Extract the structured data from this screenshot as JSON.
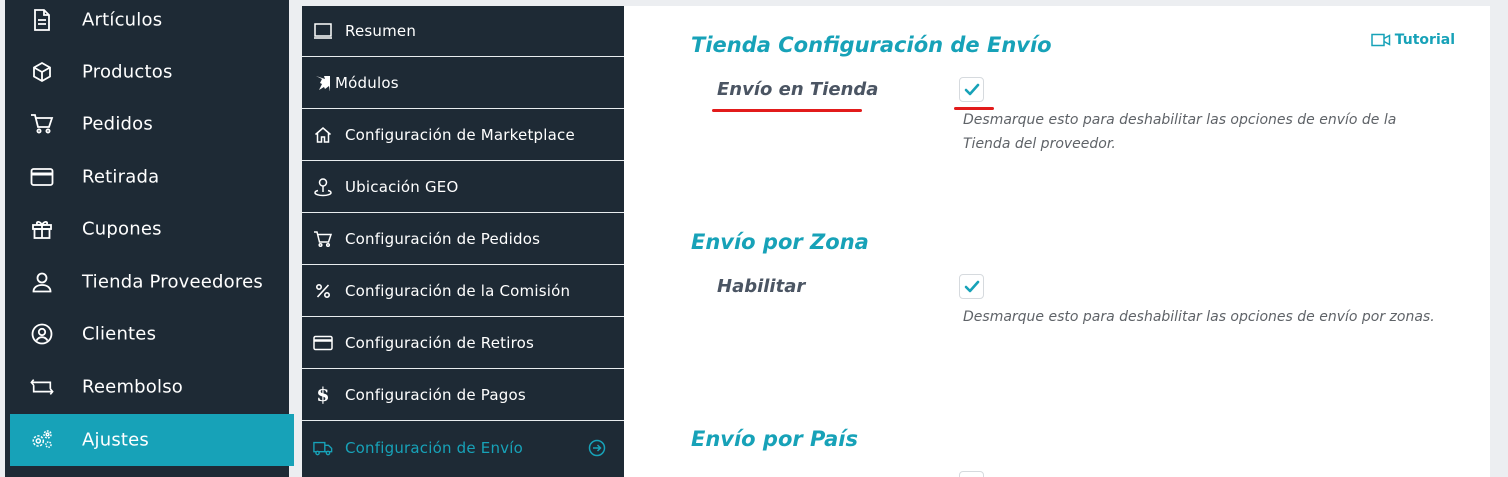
{
  "sidebar": {
    "items": [
      {
        "label": "Artículos",
        "icon": "document-icon"
      },
      {
        "label": "Productos",
        "icon": "cube-icon"
      },
      {
        "label": "Pedidos",
        "icon": "cart-icon"
      },
      {
        "label": "Retirada",
        "icon": "credit-card-icon"
      },
      {
        "label": "Cupones",
        "icon": "gift-icon"
      },
      {
        "label": "Tienda Proveedores",
        "icon": "user-icon"
      },
      {
        "label": "Clientes",
        "icon": "user-circle-icon"
      },
      {
        "label": "Reembolso",
        "icon": "repeat-icon"
      },
      {
        "label": "Ajustes",
        "icon": "gears-icon",
        "active": true
      }
    ]
  },
  "settings_menu": {
    "items": [
      {
        "label": "Resumen",
        "icon": "monitor-icon"
      },
      {
        "label": "Módulos",
        "icon": "puzzle-icon"
      },
      {
        "label": "Configuración de Marketplace",
        "icon": "home-icon"
      },
      {
        "label": "Ubicación GEO",
        "icon": "location-icon"
      },
      {
        "label": "Configuración de Pedidos",
        "icon": "cart-icon"
      },
      {
        "label": "Configuración de la Comisión",
        "icon": "percent-icon"
      },
      {
        "label": "Configuración de Retiros",
        "icon": "credit-card-icon"
      },
      {
        "label": "Configuración de Pagos",
        "icon": "dollar-icon"
      },
      {
        "label": "Configuración de Envío",
        "icon": "truck-icon",
        "active": true
      }
    ]
  },
  "content": {
    "tutorial_label": "Tutorial",
    "sections": [
      {
        "title": "Tienda Configuración de Envío",
        "field_label": "Envío en Tienda",
        "checked": true,
        "description": "Desmarque esto para deshabilitar las opciones de envío de la Tienda del proveedor."
      },
      {
        "title": "Envío por Zona",
        "field_label": "Habilitar",
        "checked": true,
        "description": "Desmarque esto para deshabilitar las opciones de envío por zonas."
      },
      {
        "title": "Envío por País"
      }
    ]
  },
  "colors": {
    "accent": "#17a2b8",
    "sidebar_bg": "#1e2a35",
    "annotation": "#e21b1b"
  }
}
